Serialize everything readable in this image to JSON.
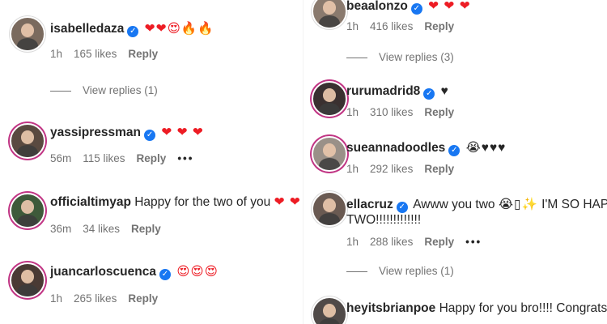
{
  "left_column": [
    {
      "username": "isabelledaza",
      "verified": true,
      "text": "",
      "emoji": "❤❤😍🔥🔥",
      "time": "1h",
      "likes": "165 likes",
      "reply": "Reply",
      "view_replies": "View replies (1)"
    },
    {
      "username": "yassipressman",
      "verified": true,
      "text": "",
      "emoji": "❤ ❤ ❤",
      "time": "56m",
      "likes": "115 likes",
      "reply": "Reply",
      "more": "•••"
    },
    {
      "username": "officialtimyap",
      "verified": false,
      "text": "Happy for the two of you",
      "emoji": "❤ ❤ ❤",
      "time": "36m",
      "likes": "34 likes",
      "reply": "Reply"
    },
    {
      "username": "juancarloscuenca",
      "verified": true,
      "text": "",
      "emoji": "😍😍😍",
      "time": "1h",
      "likes": "265 likes",
      "reply": "Reply"
    }
  ],
  "right_column": [
    {
      "username": "beaalonzo",
      "verified": true,
      "text": "",
      "emoji": "❤ ❤ ❤",
      "time": "1h",
      "likes": "416 likes",
      "reply": "Reply",
      "view_replies": "View replies (3)"
    },
    {
      "username": "rurumadrid8",
      "verified": true,
      "text": "",
      "emoji": "♥",
      "time": "1h",
      "likes": "310 likes",
      "reply": "Reply"
    },
    {
      "username": "sueannadoodles",
      "verified": true,
      "text": "",
      "emoji": "😭♥♥♥",
      "time": "1h",
      "likes": "292 likes",
      "reply": "Reply"
    },
    {
      "username": "ellacruz",
      "verified": true,
      "text": "Awww you two",
      "emoji": "😭▯✨",
      "text2": "I'M SO HAPPY FOR YOU",
      "text3": "TWO!!!!!!!!!!!!!",
      "time": "1h",
      "likes": "288 likes",
      "reply": "Reply",
      "more": "•••",
      "view_replies": "View replies (1)"
    },
    {
      "username": "heyitsbrianpoe",
      "verified": false,
      "text": "Happy for you bro!!!! Congrats!!!!",
      "emoji": ""
    }
  ],
  "colors": {
    "verified_badge": "#1877f2",
    "heart": "#ed1c24",
    "story_ring": "#c13584",
    "meta_text": "#737373"
  },
  "icons": {
    "verified": "✓"
  }
}
